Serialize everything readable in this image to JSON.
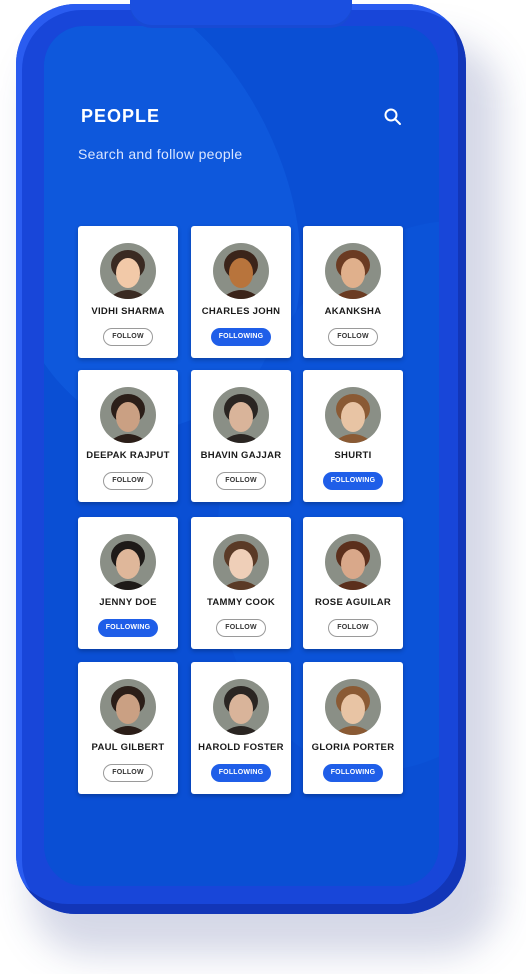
{
  "header": {
    "title": "PEOPLE",
    "subtitle": "Search and follow people",
    "search_icon": "search-icon"
  },
  "colors": {
    "screen_bg": "#0a4fd4",
    "phone_body": "#1846d9",
    "following_button": "#1f5ee8"
  },
  "people": [
    {
      "name": "VIDHI SHARMA",
      "button": "FOLLOW",
      "following": false
    },
    {
      "name": "CHARLES JOHN",
      "button": "FOLLOWING",
      "following": true
    },
    {
      "name": "AKANKSHA",
      "button": "FOLLOW",
      "following": false
    },
    {
      "name": "DEEPAK RAJPUT",
      "button": "FOLLOW",
      "following": false
    },
    {
      "name": "BHAVIN GAJJAR",
      "button": "FOLLOW",
      "following": false
    },
    {
      "name": "SHURTI",
      "button": "FOLLOWING",
      "following": true
    },
    {
      "name": "JENNY DOE",
      "button": "FOLLOWING",
      "following": true
    },
    {
      "name": "TAMMY COOK",
      "button": "FOLLOW",
      "following": false
    },
    {
      "name": "ROSE AGUILAR",
      "button": "FOLLOW",
      "following": false
    },
    {
      "name": "PAUL GILBERT",
      "button": "FOLLOW",
      "following": false
    },
    {
      "name": "HAROLD FOSTER",
      "button": "FOLLOWING",
      "following": true
    },
    {
      "name": "GLORIA PORTER",
      "button": "FOLLOWING",
      "following": true
    }
  ]
}
